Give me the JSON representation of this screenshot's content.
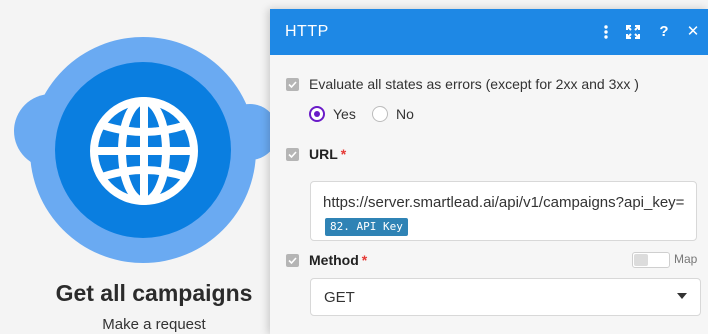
{
  "module": {
    "title": "Get all campaigns",
    "subtitle": "Make a request",
    "icon": "globe-icon",
    "colors": {
      "outer": "#6aaaf2",
      "inner": "#0a7ee0"
    }
  },
  "panel": {
    "title": "HTTP",
    "header_color": "#1e88e5",
    "header_buttons": [
      "more-vertical-icon",
      "expand-icon",
      "help-icon",
      "close-icon"
    ],
    "help_label": "?",
    "close_label": "✕",
    "evaluate_errors": {
      "label": "Evaluate all states as errors (except for 2xx and 3xx )",
      "options": [
        {
          "label": "Yes",
          "selected": true
        },
        {
          "label": "No",
          "selected": false
        }
      ]
    },
    "url": {
      "label": "URL",
      "required_mark": "*",
      "value_prefix": "https://server.smartlead.ai/api/v1/campaigns?api_key=",
      "variable_pill": "82. API Key"
    },
    "method": {
      "label": "Method",
      "required_mark": "*",
      "map_label": "Map",
      "value": "GET"
    },
    "accent_color": "#6a1bc8"
  }
}
